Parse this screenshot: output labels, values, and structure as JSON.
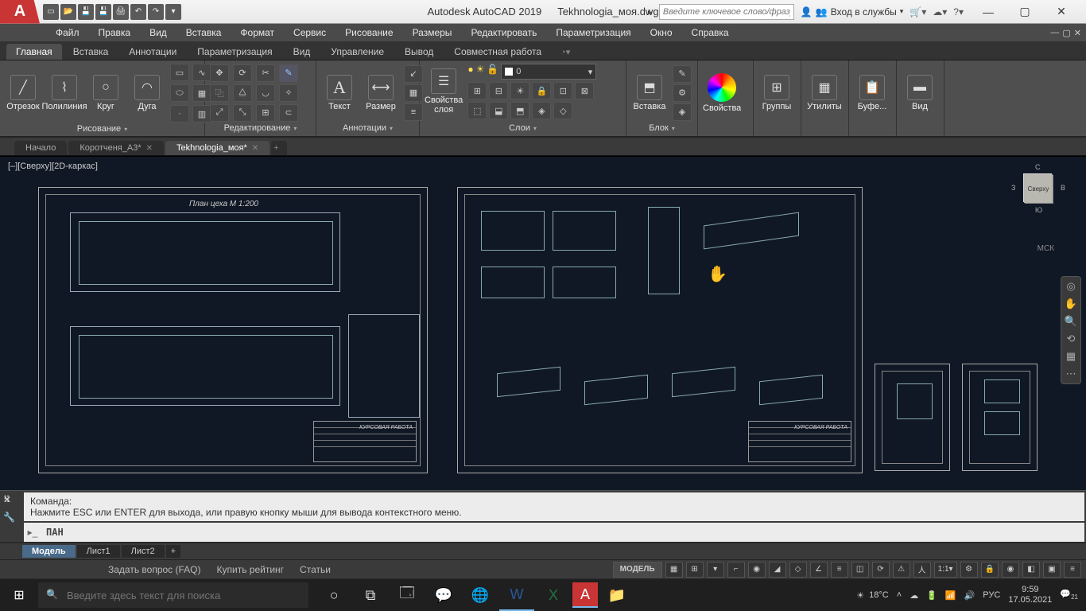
{
  "title": {
    "app": "Autodesk AutoCAD 2019",
    "file": "Tekhnologia_моя.dwg"
  },
  "search_placeholder": "Введите ключевое слово/фразу",
  "signin": "Вход в службы",
  "menu": [
    "Файл",
    "Правка",
    "Вид",
    "Вставка",
    "Формат",
    "Сервис",
    "Рисование",
    "Размеры",
    "Редактировать",
    "Параметризация",
    "Окно",
    "Справка"
  ],
  "ribbon_tabs": [
    "Главная",
    "Вставка",
    "Аннотации",
    "Параметризация",
    "Вид",
    "Управление",
    "Вывод",
    "Совместная работа"
  ],
  "ribbon_active": 0,
  "panels": {
    "draw": {
      "label": "Рисование",
      "items": [
        "Отрезок",
        "Полилиния",
        "Круг",
        "Дуга"
      ]
    },
    "modify": {
      "label": "Редактирование"
    },
    "annot": {
      "label": "Аннотации",
      "text": "Текст",
      "dim": "Размер"
    },
    "layers": {
      "label": "Слои",
      "props": "Свойства\nслоя",
      "current": "0"
    },
    "block": {
      "label": "Блок",
      "insert": "Вставка"
    },
    "props": {
      "label": "Свойства"
    },
    "groups": {
      "label": "Группы"
    },
    "utils": {
      "label": "Утилиты"
    },
    "clip": {
      "label": "Буфе..."
    },
    "view": {
      "label": "Вид"
    }
  },
  "file_tabs": [
    {
      "label": "Начало",
      "active": false,
      "closable": false
    },
    {
      "label": "Коротченя_А3*",
      "active": false,
      "closable": true
    },
    {
      "label": "Tekhnologia_моя*",
      "active": true,
      "closable": true
    }
  ],
  "viewport": {
    "label": "[–][Сверху][2D-каркас]",
    "cube_face": "Сверху",
    "cube_dirs": {
      "n": "С",
      "s": "Ю",
      "e": "В",
      "w": "З"
    },
    "wcs": "МСК",
    "plan_title": "План цеха М 1:200",
    "stamp_title": "КУРСОВАЯ РАБОТА"
  },
  "command": {
    "line1": "Команда:",
    "line2": "Нажмите ESC или ENTER для выхода, или правую кнопку мыши для вывода контекстного меню.",
    "current": "ПАН"
  },
  "layout_tabs": [
    "Модель",
    "Лист1",
    "Лист2"
  ],
  "layout_active": 0,
  "status": {
    "links": [
      "Задать вопрос (FAQ)",
      "Купить рейтинг",
      "Статьи"
    ],
    "model": "МОДЕЛЬ",
    "scale": "1:1"
  },
  "taskbar": {
    "search_placeholder": "Введите здесь текст для поиска",
    "weather": "18°C",
    "lang": "РУС",
    "time": "9:59",
    "date": "17.05.2021",
    "notif": "21"
  }
}
